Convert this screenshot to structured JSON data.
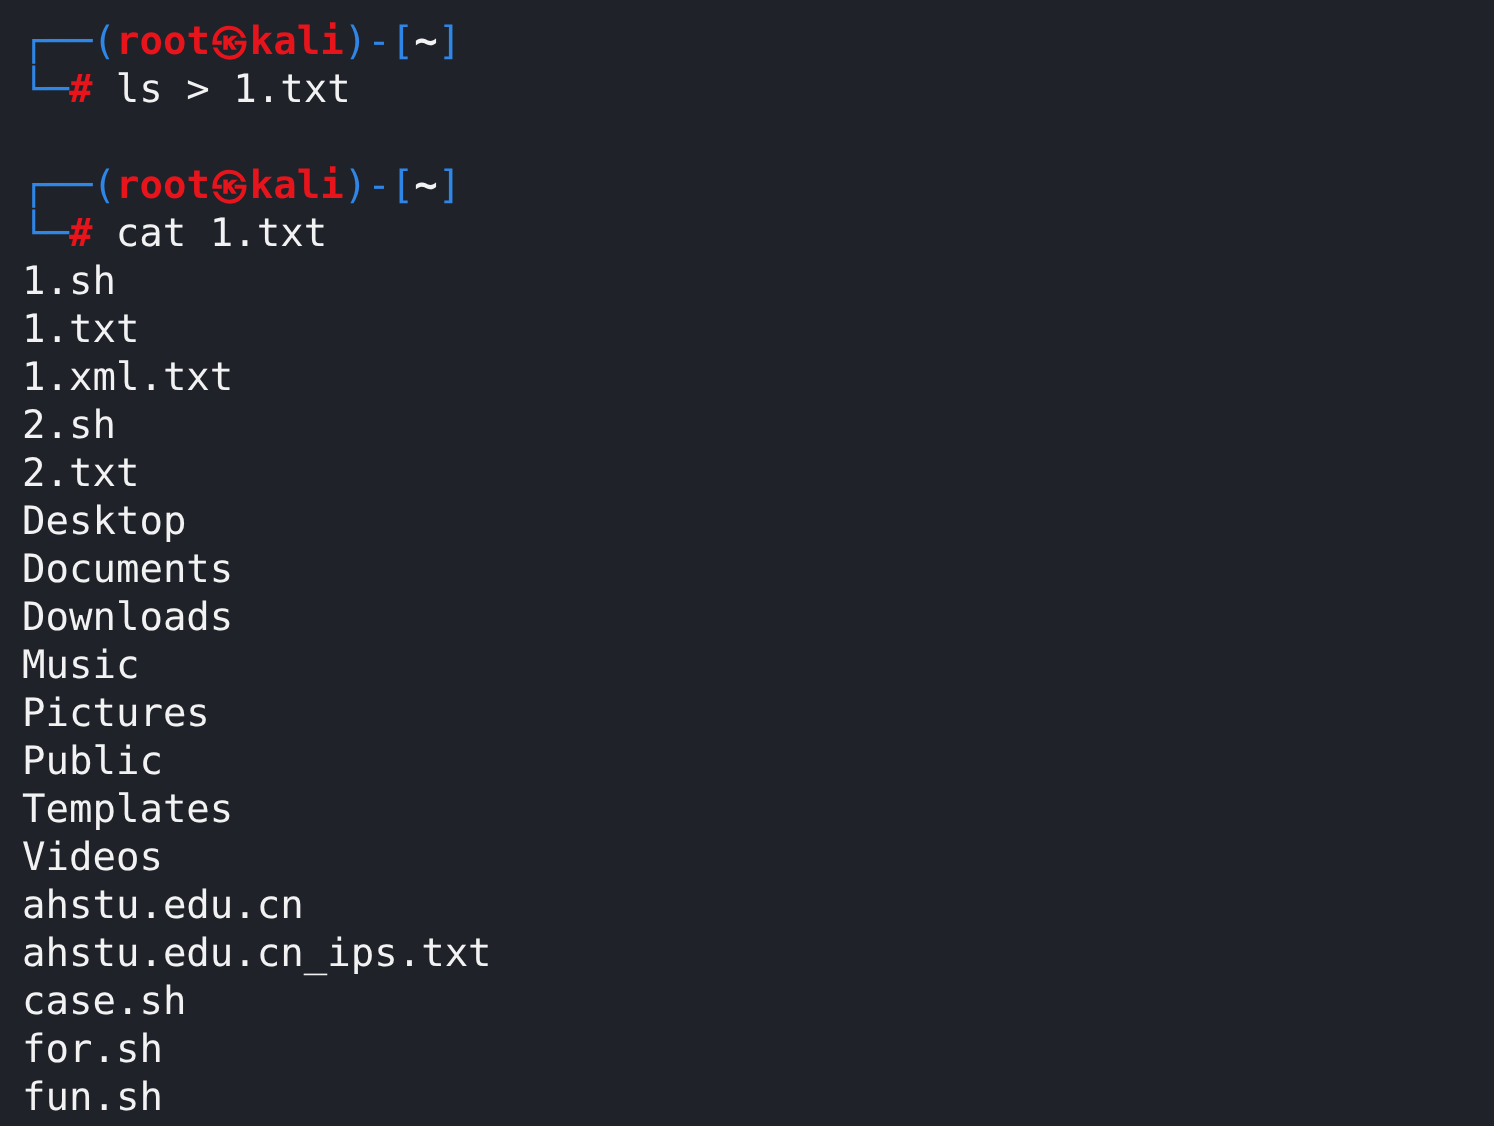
{
  "terminal": {
    "blocks": [
      {
        "prompt_line": [
          {
            "kind": "frame",
            "text": "┌──("
          },
          {
            "kind": "user",
            "text": "root㉿kali"
          },
          {
            "kind": "frame",
            "text": ")-["
          },
          {
            "kind": "path",
            "text": "~"
          },
          {
            "kind": "frame",
            "text": "]"
          }
        ],
        "input_line": [
          {
            "kind": "frame",
            "text": "└─"
          },
          {
            "kind": "symbol",
            "text": "#"
          },
          {
            "kind": "command",
            "text": "ls > 1.txt"
          }
        ]
      },
      {
        "prompt_line": [
          {
            "kind": "frame",
            "text": "┌──("
          },
          {
            "kind": "user",
            "text": "root㉿kali"
          },
          {
            "kind": "frame",
            "text": ")-["
          },
          {
            "kind": "path",
            "text": "~"
          },
          {
            "kind": "frame",
            "text": "]"
          }
        ],
        "input_line": [
          {
            "kind": "frame",
            "text": "└─"
          },
          {
            "kind": "symbol",
            "text": "#"
          },
          {
            "kind": "command",
            "text": "cat 1.txt"
          }
        ],
        "output": [
          "1.sh",
          "1.txt",
          "1.xml.txt",
          "2.sh",
          "2.txt",
          "Desktop",
          "Documents",
          "Downloads",
          "Music",
          "Pictures",
          "Public",
          "Templates",
          "Videos",
          "ahstu.edu.cn",
          "ahstu.edu.cn_ips.txt",
          "case.sh",
          "for.sh",
          "fun.sh"
        ]
      }
    ]
  }
}
